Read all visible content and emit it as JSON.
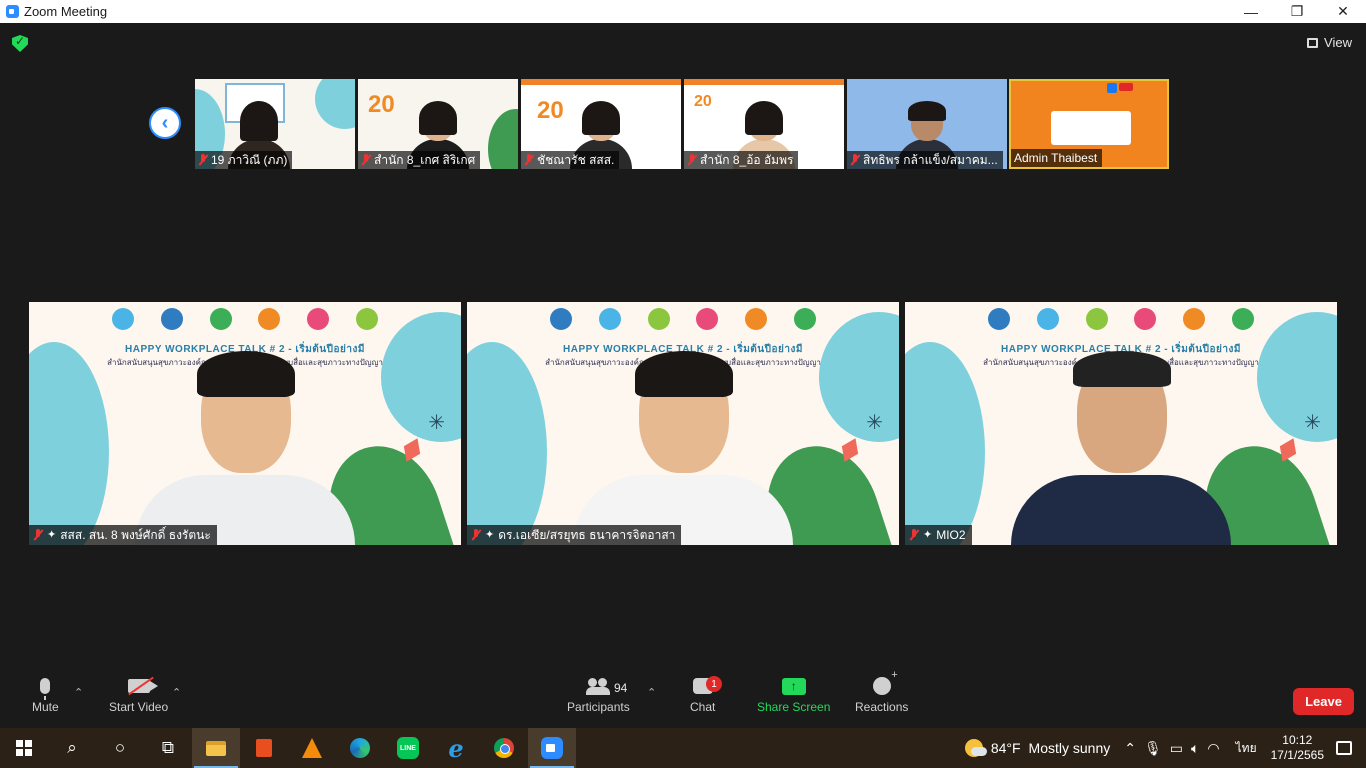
{
  "window": {
    "title": "Zoom Meeting",
    "controls": [
      "—",
      "❐",
      "✕"
    ]
  },
  "meeting": {
    "view_label": "View",
    "thumbnails": [
      {
        "name": "19 ภาวิณี  (ภภ)"
      },
      {
        "name": "สำนัก 8_เกศ สิริเกศ"
      },
      {
        "name": "ชัชณารัช สสส."
      },
      {
        "name": "สำนัก 8_อ้อ อัมพร"
      },
      {
        "name": "สิทธิพร กล้าแข็ง/สมาคม..."
      },
      {
        "name": "Admin Thaibest"
      }
    ],
    "gallery": [
      {
        "name": "สสส. สน. 8 พงษ์ศักดิ์ ธงรัตนะ",
        "banner_title": "HAPPY WORKPLACE TALK # 2 - เริ่มต้นปีอย่างมี",
        "banner_sub": "สำนักสนับสนุนสุขภาวะองค์กร  X  สำนักสร้างเสริมระบบสื่อและสุขภาวะทางปัญญา"
      },
      {
        "name": "ดร.เอเซีย/สรยุทธ ธนาคารจิตอาสา",
        "banner_title": "HAPPY WORKPLACE TALK # 2 - เริ่มต้นปีอย่างมี",
        "banner_sub": "สำนักสนับสนุนสุขภาวะองค์กร  X  สำนักสร้างเสริมระบบสื่อและสุขภาวะทางปัญญา"
      },
      {
        "name": "MIO2",
        "banner_title": "HAPPY WORKPLACE TALK # 2 - เริ่มต้นปีอย่างมี",
        "banner_sub": "สำนักสนับสนุนสุขภาวะองค์กร  X  สำนักสร้างเสริมระบบสื่อและสุขภาวะทางปัญญา"
      }
    ]
  },
  "toolbar": {
    "mute_label": "Mute",
    "video_label": "Start Video",
    "participants_label": "Participants",
    "participants_count": "94",
    "chat_label": "Chat",
    "chat_badge": "1",
    "share_label": "Share Screen",
    "reactions_label": "Reactions",
    "leave_label": "Leave"
  },
  "taskbar": {
    "weather_temp": "84°F",
    "weather_desc": "Mostly sunny",
    "language": "ไทย",
    "time": "10:12",
    "date": "17/1/2565"
  },
  "colors": {
    "zoom_blue": "#2d8cff",
    "leave_red": "#e02828",
    "share_green": "#23d959"
  }
}
